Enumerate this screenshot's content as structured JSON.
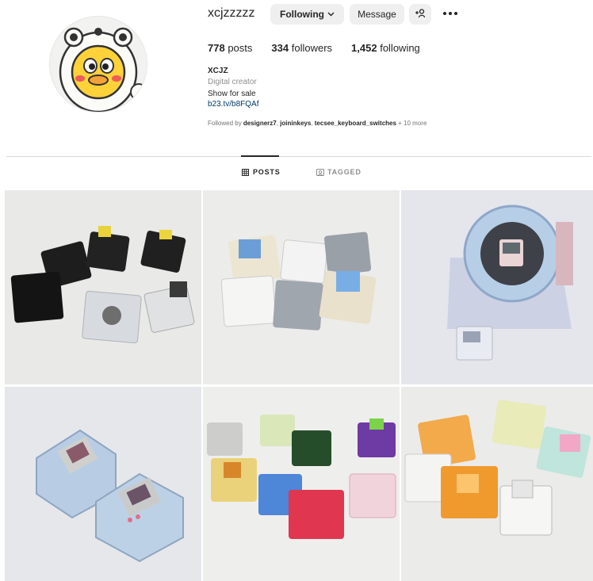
{
  "profile": {
    "username": "xcjzzzzz",
    "following_label": "Following",
    "message_label": "Message",
    "posts_count": "778",
    "posts_label": "posts",
    "followers_count": "334",
    "followers_label": "followers",
    "following_count": "1,452",
    "following_stat_label": "following",
    "full_name": "XCJZ",
    "category": "Digital creator",
    "bio": "Show for sale",
    "link": "b23.tv/b8FQAf",
    "followed_by_prefix": "Followed by ",
    "followed_by_1": "designerz7",
    "followed_by_2": "joininkeys",
    "followed_by_3": "tecsee_keyboard_switches",
    "followed_by_suffix": " + 10 more"
  },
  "tabs": {
    "posts": "POSTS",
    "tagged": "TAGGED"
  },
  "icons": {
    "following_chevron": "chevron-down-icon",
    "add_user": "add-user-icon",
    "more": "more-options-icon",
    "posts_tab": "grid-icon",
    "tagged_tab": "tag-icon"
  },
  "colors": {
    "button_bg": "#efefef",
    "link": "#00376b",
    "muted": "#8e8e8e"
  }
}
